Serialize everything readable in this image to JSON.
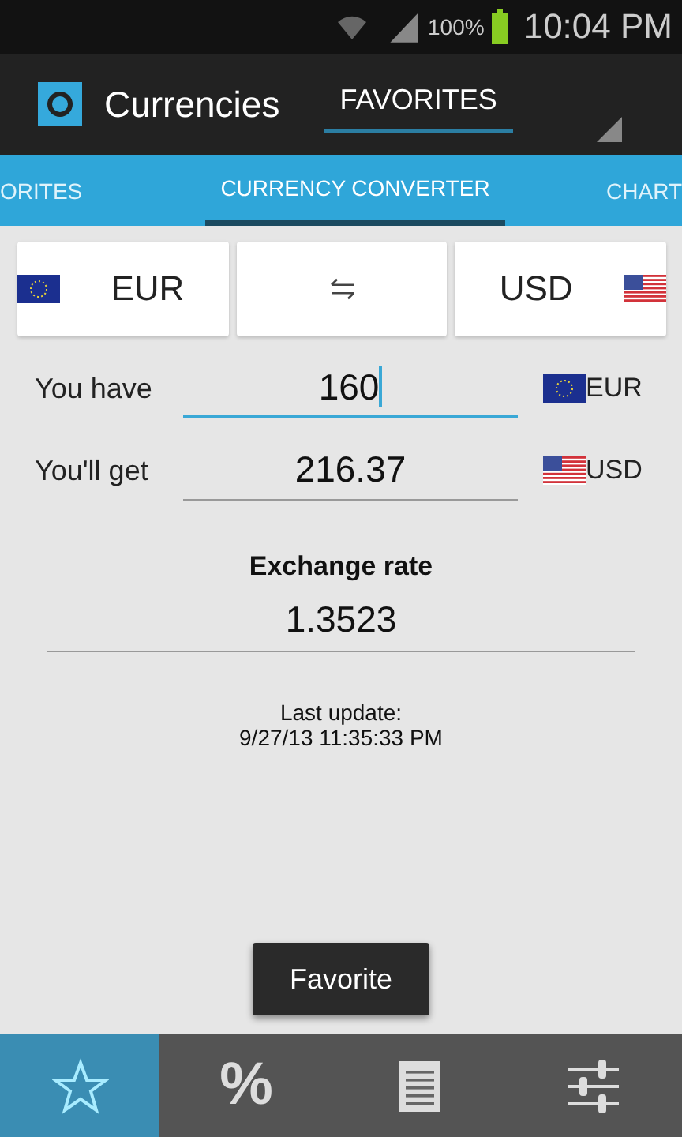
{
  "status_bar": {
    "battery": "100%",
    "time": "10:04 PM"
  },
  "action_bar": {
    "title": "Currencies",
    "spinner": "FAVORITES"
  },
  "tabs": [
    {
      "label": "ORITES",
      "selected": false
    },
    {
      "label": "CURRENCY CONVERTER",
      "selected": true
    },
    {
      "label": "CHART",
      "selected": false
    }
  ],
  "currency_pair": {
    "from": {
      "code": "EUR",
      "kind": "eu"
    },
    "to": {
      "code": "USD",
      "kind": "us"
    }
  },
  "rows": [
    {
      "label": "You have",
      "value": "160",
      "focused": true,
      "currency": "EUR",
      "kind": "eu"
    },
    {
      "label": "You'll get",
      "value": "216.37",
      "focused": false,
      "currency": "USD",
      "kind": "us"
    }
  ],
  "exchange_rate": {
    "heading": "Exchange rate",
    "value": "1.3523"
  },
  "last_update": {
    "label": "Last update:",
    "timestamp": "9/27/13 11:35:33 PM"
  },
  "toast": "Favorite",
  "bottom_nav": [
    {
      "kind": "star",
      "selected": true
    },
    {
      "kind": "text",
      "label": "%",
      "selected": false
    },
    {
      "kind": "document",
      "selected": false
    },
    {
      "kind": "sliders",
      "selected": false
    }
  ]
}
